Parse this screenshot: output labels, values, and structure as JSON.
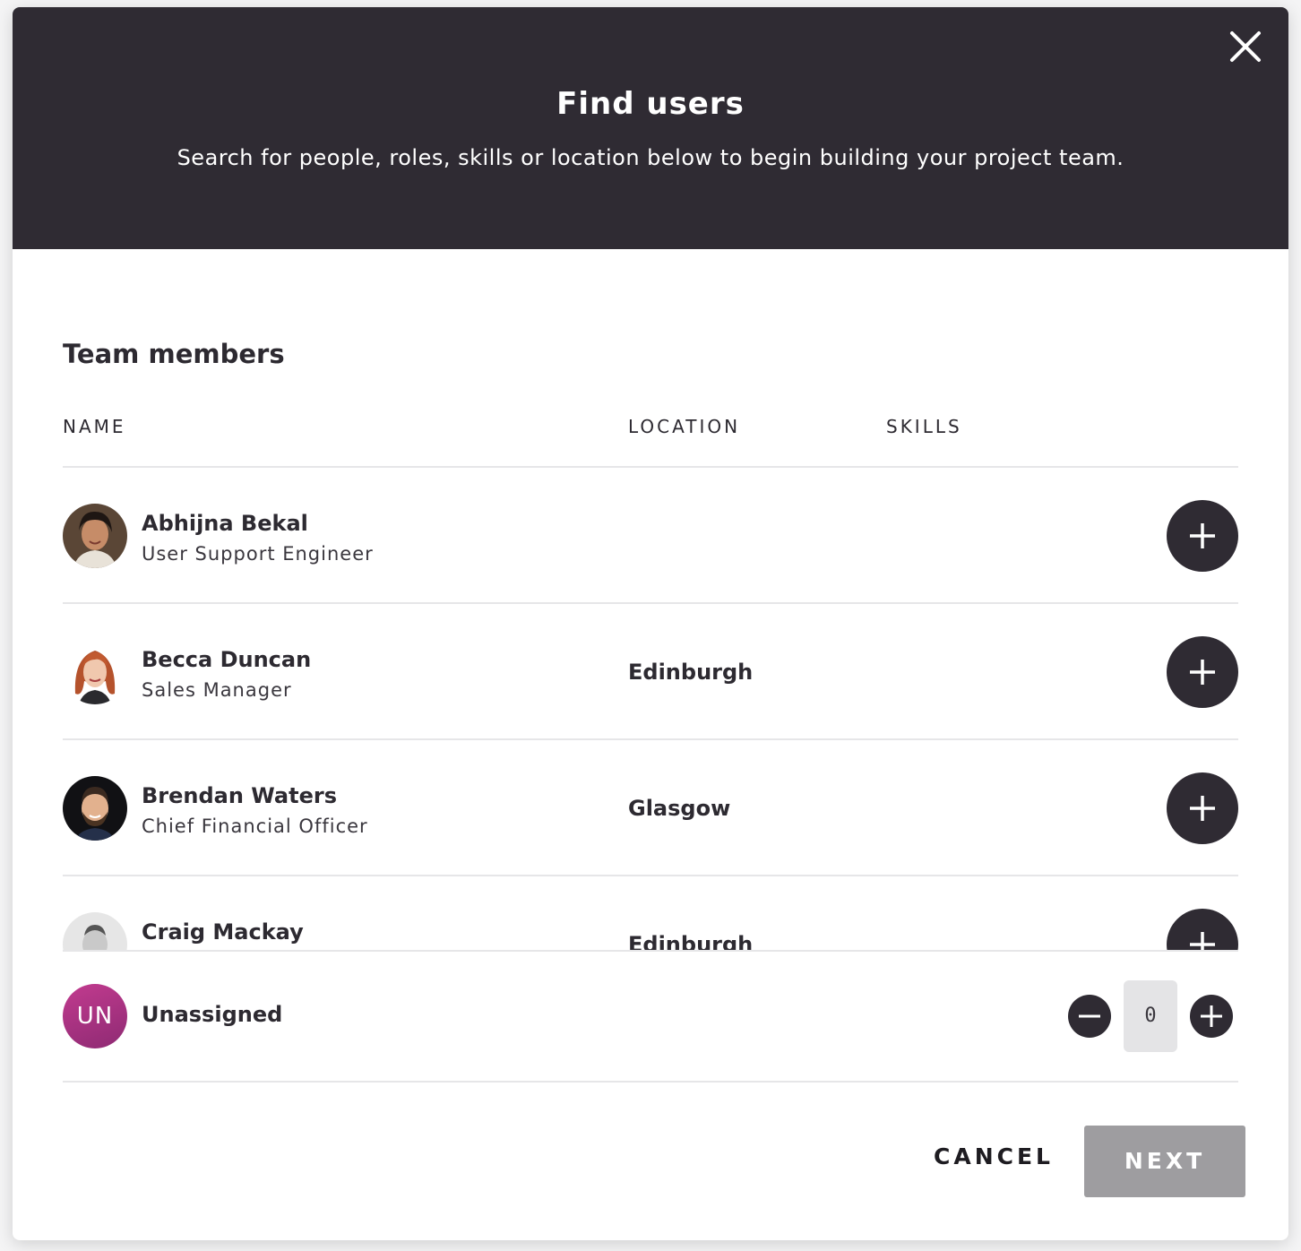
{
  "modal": {
    "title": "Find users",
    "subtitle": "Search for people, roles, skills or location below to begin building your project team."
  },
  "team": {
    "section_title": "Team members",
    "columns": {
      "name": "NAME",
      "location": "LOCATION",
      "skills": "SKILLS"
    },
    "members": [
      {
        "name": "Abhijna Bekal",
        "role": "User Support Engineer",
        "location": ""
      },
      {
        "name": "Becca Duncan",
        "role": "Sales Manager",
        "location": "Edinburgh"
      },
      {
        "name": "Brendan Waters",
        "role": "Chief Financial Officer",
        "location": "Glasgow"
      },
      {
        "name": "Craig Mackay",
        "role": "",
        "location": "Edinburgh"
      }
    ]
  },
  "unassigned": {
    "initials": "UN",
    "label": "Unassigned",
    "count": "0"
  },
  "footer": {
    "cancel_label": "CANCEL",
    "next_label": "NEXT"
  },
  "colors": {
    "header_bg": "#2f2b33",
    "accent_unassigned": "#b0357f",
    "next_disabled": "#9e9da0"
  }
}
